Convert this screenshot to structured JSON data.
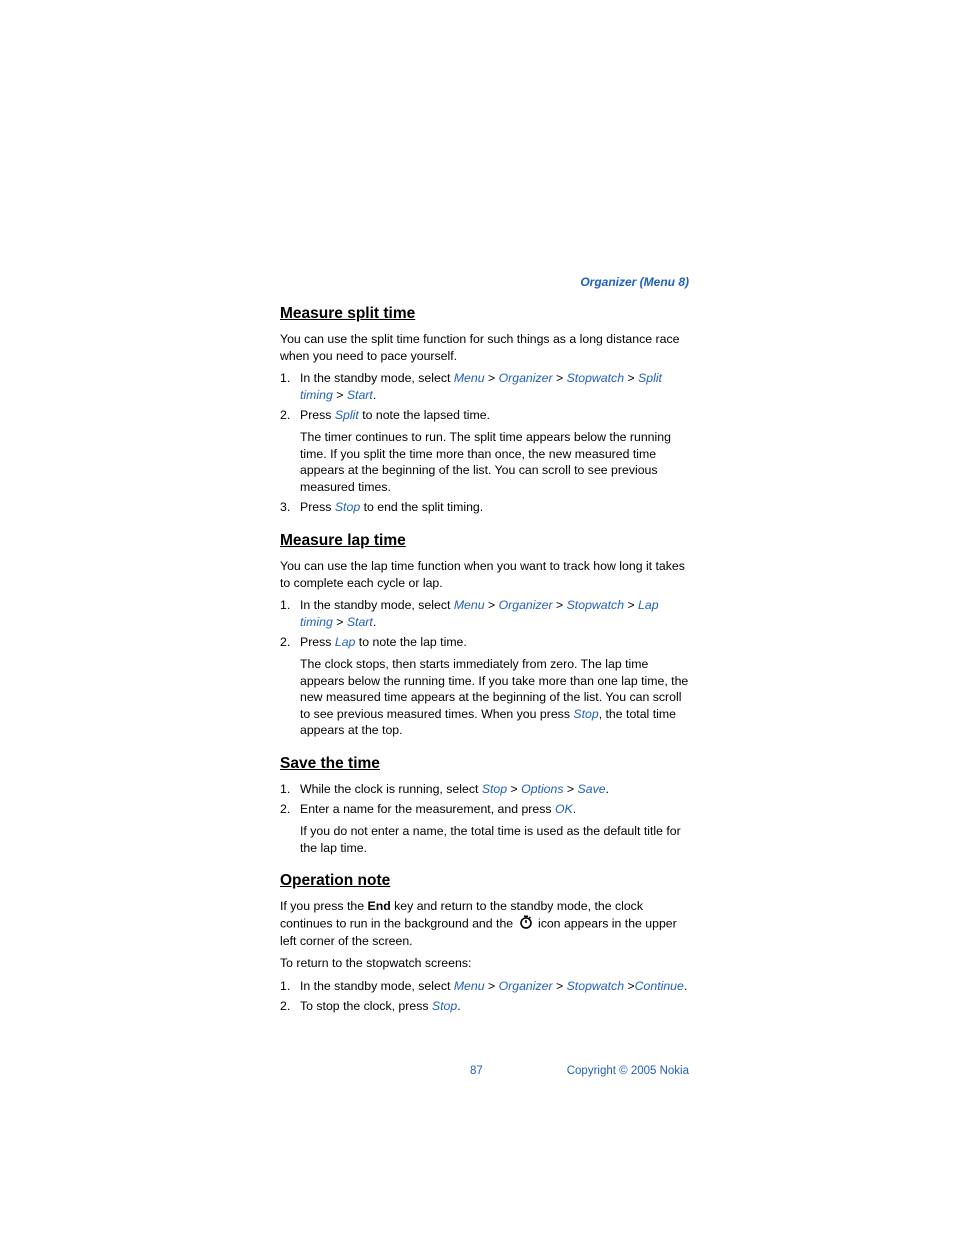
{
  "header": {
    "breadcrumb": "Organizer (Menu 8)"
  },
  "sections": {
    "split": {
      "title": "Measure split time",
      "intro": "You can use the split time function for such things as a long distance race when you need to pace yourself.",
      "step1": {
        "pre": "In the standby mode, select ",
        "menu": "Menu",
        "sep1": " > ",
        "organizer": "Organizer",
        "sep2": " > ",
        "stopwatch": "Stopwatch",
        "sep3": " > ",
        "splittiming": "Split timing",
        "sep4": " > ",
        "start": "Start",
        "period": "."
      },
      "step2": {
        "pre": "Press ",
        "split": "Split",
        "post": " to note the lapsed time.",
        "note": "The timer continues to run. The split time appears below the running time. If you split the time more than once, the new measured time appears at the beginning of the list. You can scroll to see previous measured times."
      },
      "step3": {
        "pre": "Press ",
        "stop": "Stop",
        "post": " to end the split timing."
      }
    },
    "lap": {
      "title": "Measure lap time",
      "intro": "You can use the lap time function when you want to track how long it takes to complete each cycle or lap.",
      "step1": {
        "pre": "In the standby mode, select ",
        "menu": "Menu",
        "sep1": " > ",
        "organizer": "Organizer",
        "sep2": " > ",
        "stopwatch": "Stopwatch",
        "sep3": " > ",
        "laptiming": "Lap timing",
        "sep4": " > ",
        "start": "Start",
        "period": "."
      },
      "step2": {
        "pre": "Press ",
        "lap": "Lap",
        "post": " to note the lap time.",
        "note_a": "The clock stops, then starts immediately from zero. The lap time appears below the running time. If you take more than one lap time, the new measured time appears at the beginning of the list. You can scroll to see previous measured times. When you press ",
        "stop": "Stop",
        "note_b": ", the total time appears at the top."
      }
    },
    "save": {
      "title": "Save the time",
      "step1": {
        "pre": "While the clock is running, select ",
        "stop": "Stop",
        "sep1": " > ",
        "options": "Options",
        "sep2": " > ",
        "save": "Save",
        "period": "."
      },
      "step2": {
        "pre": "Enter a name for the measurement, and press ",
        "ok": "OK",
        "period": ".",
        "note": "If you do not enter a name, the total time is used as the default title for the lap time."
      }
    },
    "opnote": {
      "title": "Operation note",
      "p1a": "If you press the ",
      "end": "End",
      "p1b": " key and return to the standby mode, the clock continues to run in the background and the ",
      "p1c": " icon appears in the upper left corner of the screen.",
      "p2": "To return to the stopwatch screens:",
      "step1": {
        "pre": "In the standby mode, select ",
        "menu": "Menu",
        "sep1": " > ",
        "organizer": "Organizer",
        "sep2": " > ",
        "stopwatch": "Stopwatch",
        "sep3": " >",
        "continue": "Continue",
        "period": "."
      },
      "step2": {
        "pre": "To stop the clock, press ",
        "stop": "Stop",
        "period": "."
      }
    }
  },
  "footer": {
    "page": "87",
    "copyright": "Copyright © 2005 Nokia"
  }
}
